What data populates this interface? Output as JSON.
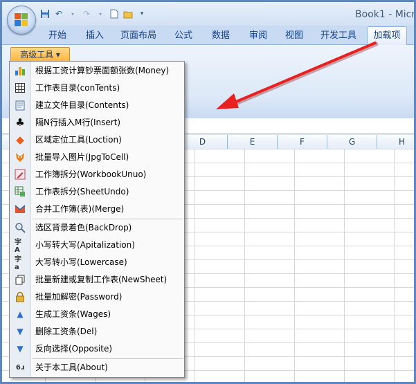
{
  "window": {
    "title": "Book1 - Micr"
  },
  "tabs": [
    "开始",
    "插入",
    "页面布局",
    "公式",
    "数据",
    "审阅",
    "视图",
    "开发工具",
    "加载项"
  ],
  "active_tab": "加载项",
  "ribbon": {
    "adv_tools_label": "高级工具 ▾"
  },
  "columns": [
    "D",
    "E",
    "F",
    "G",
    "H"
  ],
  "menu": {
    "items": [
      {
        "label": "根据工资计算钞票面额张数(Money)",
        "icon": "bar-chart-icon"
      },
      {
        "label": "工作表目录(conTents)",
        "icon": "table-grid-icon"
      },
      {
        "label": "建立文件目录(Contents)",
        "icon": "document-icon"
      },
      {
        "label": "隔N行插入M行(Insert)",
        "icon": "club-icon"
      },
      {
        "label": "区域定位工具(Loction)",
        "icon": "diamond-icon"
      },
      {
        "label": "批量导入图片(JpgToCell)",
        "icon": "fox-icon"
      },
      {
        "label": "工作簿拆分(WorkbookUnuo)",
        "icon": "pen-icon"
      },
      {
        "label": "工作表拆分(SheetUndo)",
        "icon": "sheet-split-icon"
      },
      {
        "label": "合并工作簿(表)(Merge)",
        "icon": "merge-icon"
      },
      {
        "label": "选区背景着色(BackDrop)",
        "icon": "magnifier-icon"
      },
      {
        "label": "小写转大写(Apitalization)",
        "icon": "case-upper-icon"
      },
      {
        "label": "大写转小写(Lowercase)",
        "icon": "case-lower-icon"
      },
      {
        "label": "批量新建或复制工作表(NewSheet)",
        "icon": "copy-sheet-icon"
      },
      {
        "label": "批量加解密(Password)",
        "icon": "lock-icon"
      },
      {
        "label": "生成工资条(Wages)",
        "icon": "arrow-up-icon"
      },
      {
        "label": "删除工资条(Del)",
        "icon": "arrow-down-icon"
      },
      {
        "label": "反向选择(Opposite)",
        "icon": "arrow-down-icon"
      },
      {
        "label": "关于本工具(About)",
        "icon": "about-icon"
      }
    ]
  },
  "colors": {
    "accent": "#ffb43d",
    "arrow": "#e8201f",
    "text": "#15428b"
  }
}
